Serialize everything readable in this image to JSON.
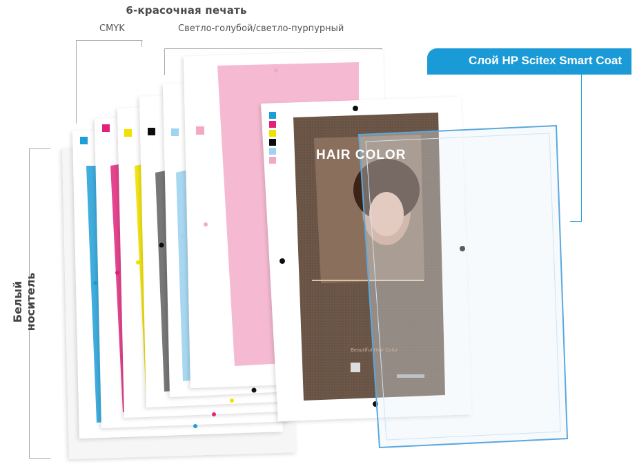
{
  "header": {
    "title": "6-красочная печать",
    "cmyk_label": "CMYK",
    "light_label": "Светло-голубой/светло-пурпурный"
  },
  "layer_badge": {
    "label": "Слой HP Scitex Smart Coat",
    "color": "#1a9ad7"
  },
  "side_label": "Белый носитель",
  "poster": {
    "title": "HAIR COLOR",
    "tagline": "Beautiful Hair Color",
    "background": "#6b5546"
  },
  "ink_colors": {
    "cyan": "#1e9fd8",
    "magenta": "#e0247a",
    "yellow": "#f2e100",
    "black": "#111111",
    "light_cyan": "#9ed4f0",
    "light_magenta": "#f2a9c6"
  }
}
